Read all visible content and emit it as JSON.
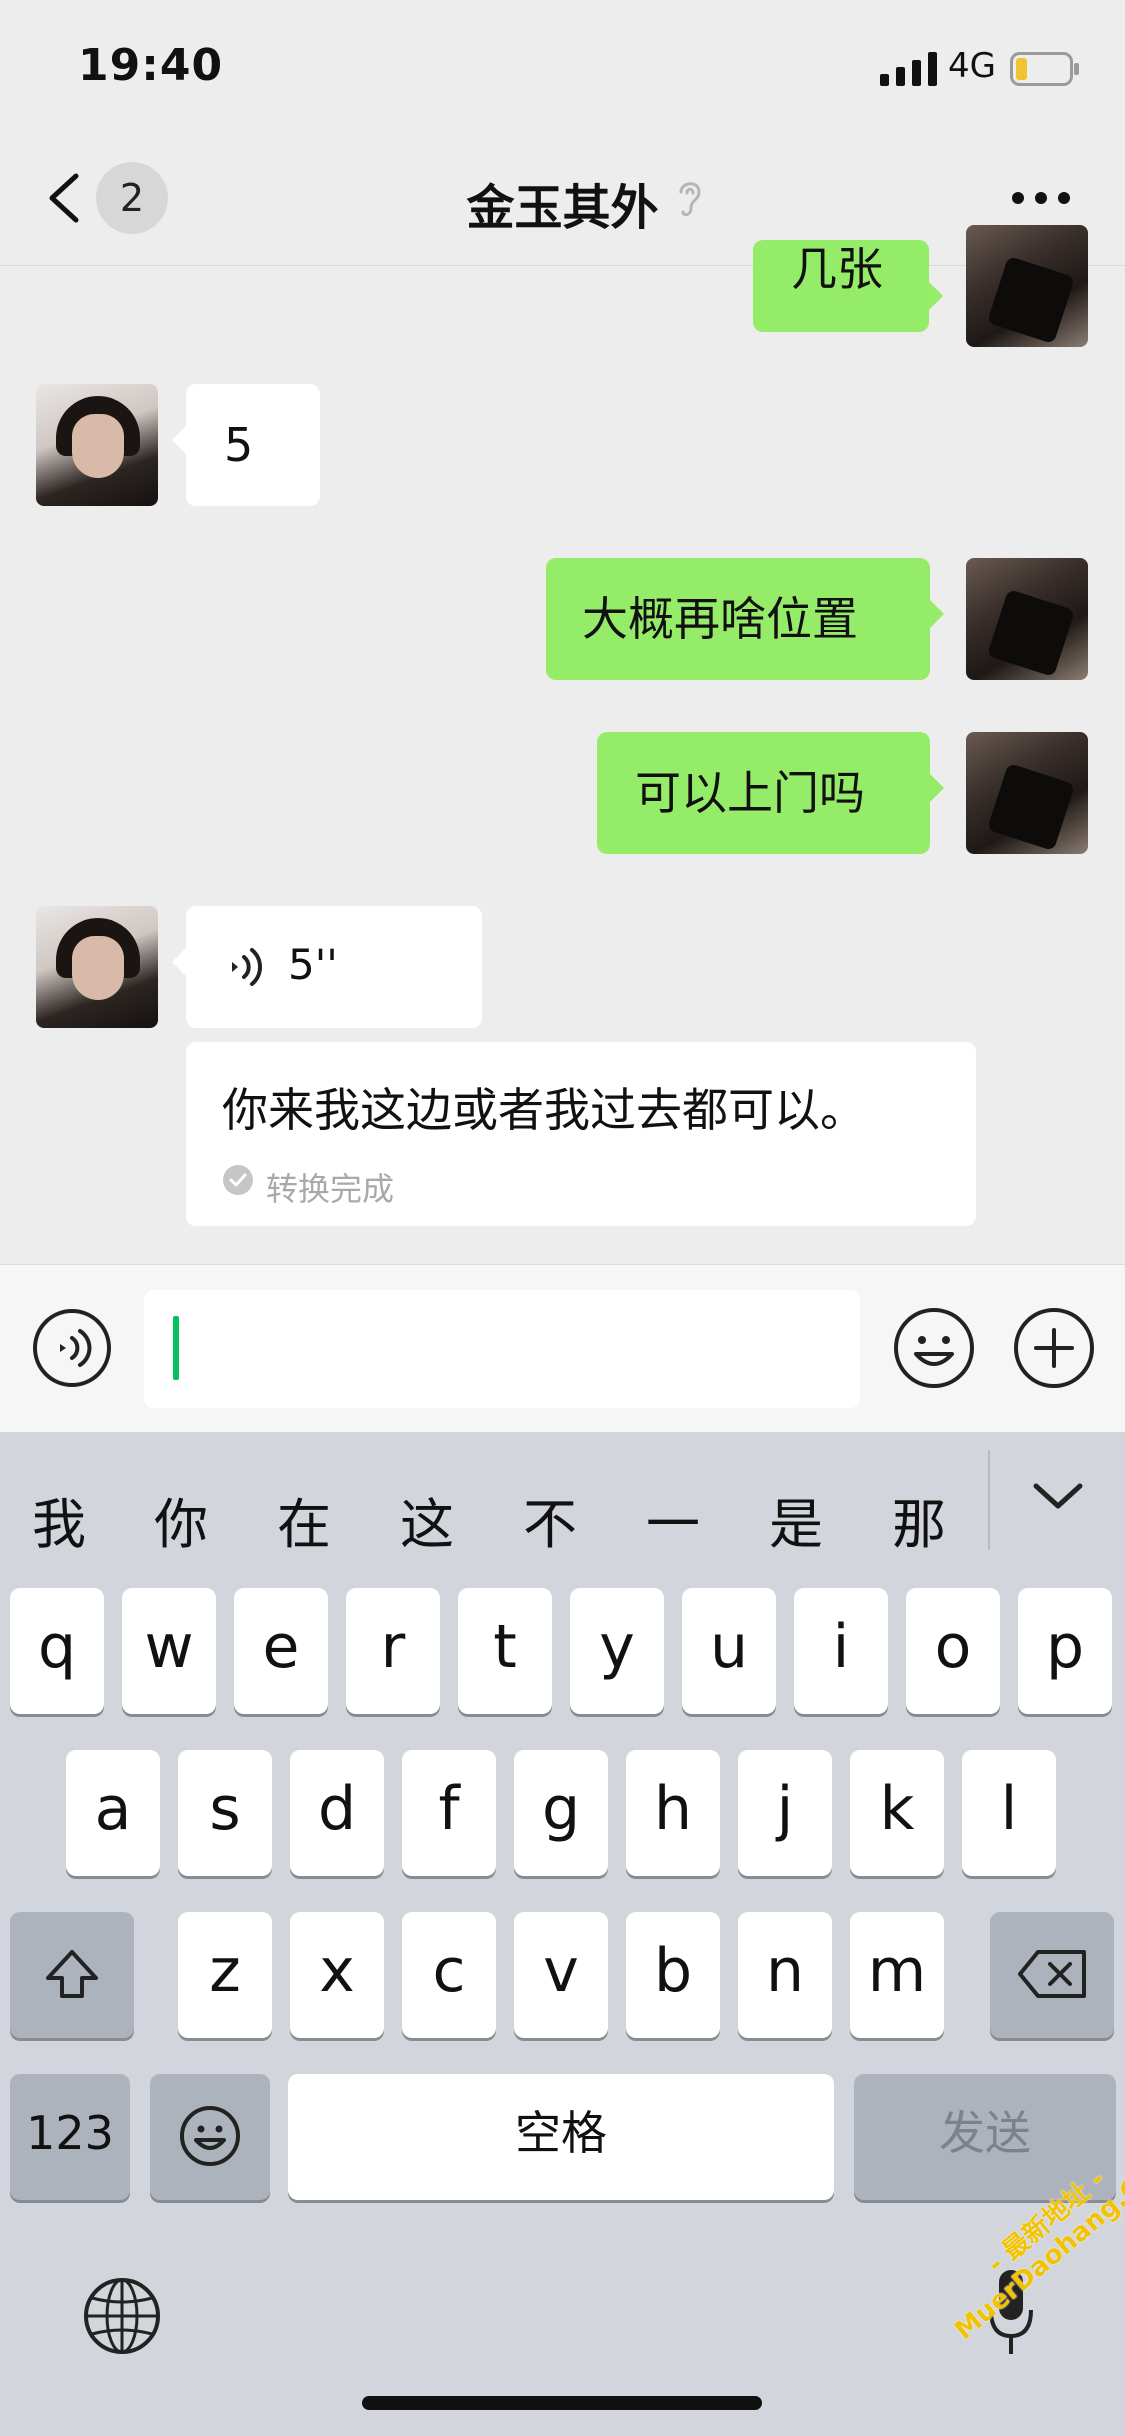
{
  "status_bar": {
    "time": "19:40",
    "network": "4G"
  },
  "nav": {
    "unread_count": "2",
    "title": "金玉其外"
  },
  "messages": [
    {
      "side": "right",
      "type": "text",
      "text": "几张"
    },
    {
      "side": "left",
      "type": "text",
      "text": "5"
    },
    {
      "side": "right",
      "type": "text",
      "text": "大概再啥位置"
    },
    {
      "side": "right",
      "type": "text",
      "text": "可以上门吗"
    },
    {
      "side": "left",
      "type": "voice",
      "duration": "5''",
      "transcript": "你来我这边或者我过去都可以。",
      "transcript_status": "转换完成"
    }
  ],
  "input": {
    "value": ""
  },
  "keyboard": {
    "candidates": [
      "我",
      "你",
      "在",
      "这",
      "不",
      "一",
      "是",
      "那"
    ],
    "rows": [
      [
        "q",
        "w",
        "e",
        "r",
        "t",
        "y",
        "u",
        "i",
        "o",
        "p"
      ],
      [
        "a",
        "s",
        "d",
        "f",
        "g",
        "h",
        "j",
        "k",
        "l"
      ],
      [
        "z",
        "x",
        "c",
        "v",
        "b",
        "n",
        "m"
      ]
    ],
    "numbers_label": "123",
    "space_label": "空格",
    "send_label": "发送"
  },
  "watermark": {
    "line1": "- 最新地址 -",
    "line2": "MuerDaohang.Com"
  },
  "colors": {
    "sent_bubble": "#95ec69",
    "received_bubble": "#ffffff",
    "cursor": "#07c160",
    "watermark": "#f2c300"
  }
}
